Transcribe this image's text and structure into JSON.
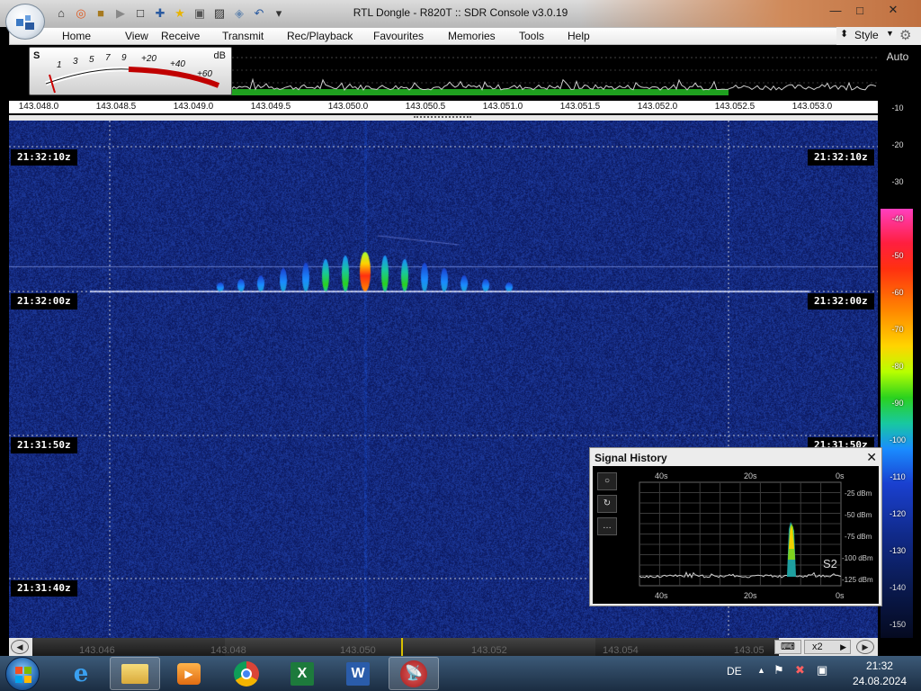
{
  "window": {
    "title": "RTL Dongle - R820T :: SDR Console v3.0.19"
  },
  "menu": [
    "Home",
    "View",
    "Receive",
    "Transmit",
    "Rec/Playback",
    "Favourites",
    "Memories",
    "Tools",
    "Help"
  ],
  "style_label": "Style",
  "quick_access_icons": [
    "home-icon",
    "lifebuoy-icon",
    "folder-icon",
    "play-icon",
    "stop-icon",
    "plus-icon",
    "star-icon",
    "lock-icon",
    "camera-icon",
    "drop-icon",
    "undo-icon",
    "dropdown-icon"
  ],
  "smeter": {
    "s_label": "S",
    "db_label": "dB",
    "scale": [
      "1",
      "3",
      "5",
      "7",
      "9",
      "+20",
      "+40",
      "+60"
    ]
  },
  "freq_axis": [
    "143.048.0",
    "143.048.5",
    "143.049.0",
    "143.049.5",
    "143.050.0",
    "143.050.5",
    "143.051.0",
    "143.051.5",
    "143.052.0",
    "143.052.5",
    "143.053.0"
  ],
  "db_scale": {
    "auto_label": "Auto",
    "labels": [
      "-10",
      "-20",
      "-30",
      "-40",
      "-50",
      "-60",
      "-70",
      "-80",
      "-90",
      "-100",
      "-110",
      "-120",
      "-130",
      "-140",
      "-150"
    ]
  },
  "timestamps": [
    "21:32:10z",
    "21:32:00z",
    "21:31:50z",
    "21:31:40z"
  ],
  "signal_history": {
    "title": "Signal History",
    "close": "✕",
    "buttons": [
      "○",
      "↻",
      "…"
    ],
    "x_top": [
      "40s",
      "20s",
      "0s"
    ],
    "x_bottom": [
      "40s",
      "20s",
      "0s"
    ],
    "y_labels": [
      "-25 dBm",
      "-50 dBm",
      "-75 dBm",
      "-100 dBm",
      "-125 dBm"
    ],
    "s_reading": "S2"
  },
  "overview_scroll": {
    "labels": [
      "143.046",
      "143.048",
      "143.050",
      "143.052",
      "143.054",
      "143.05"
    ],
    "zoom": "x2"
  },
  "taskbar": {
    "apps": [
      "internet-explorer",
      "file-explorer",
      "media-player",
      "chrome",
      "excel",
      "word",
      "sdr-console"
    ],
    "language": "DE",
    "time": "21:32",
    "date": "24.08.2024"
  },
  "colors": {
    "waterfall_bg": "#101a6a",
    "signal_peak": "#ff2a10",
    "green_bar": "#1fa01f"
  }
}
